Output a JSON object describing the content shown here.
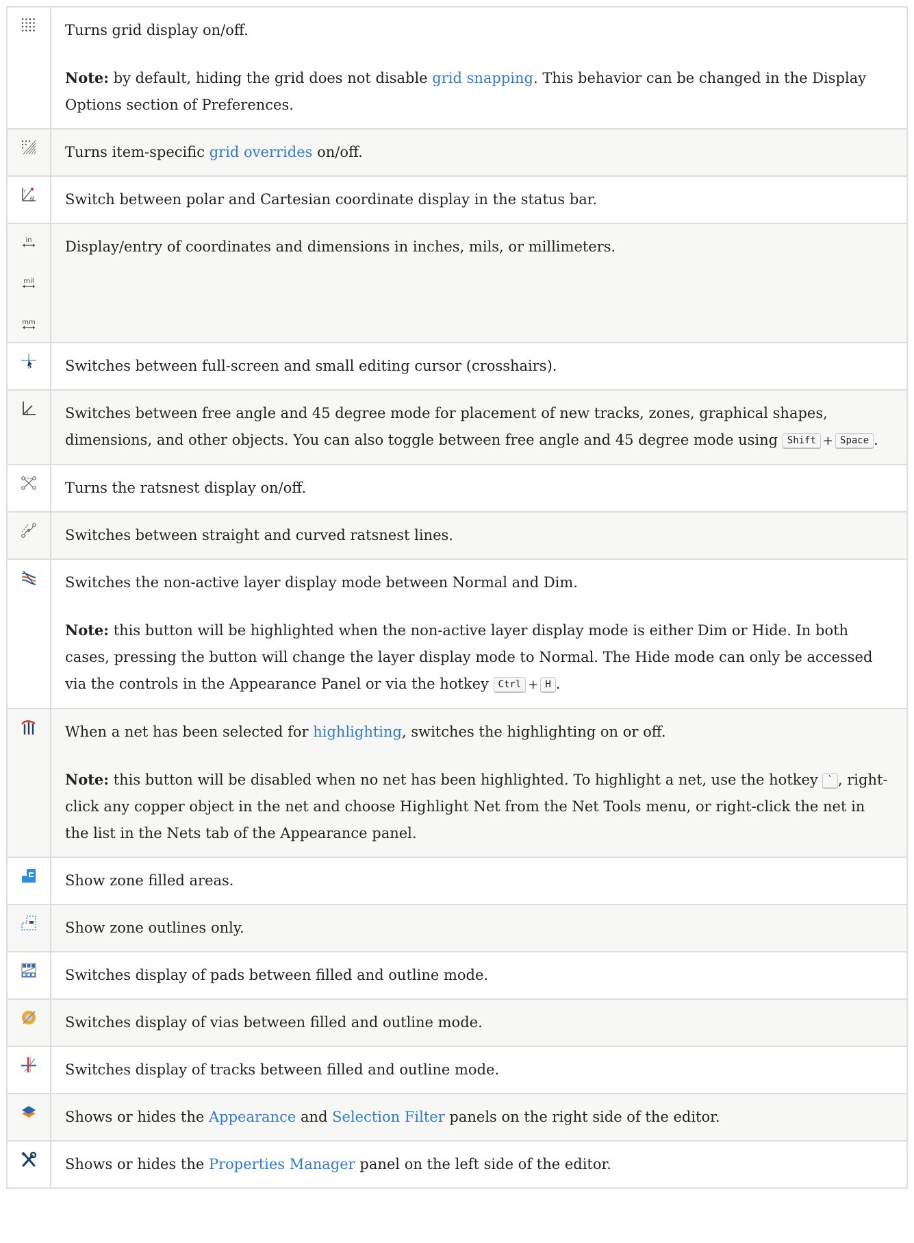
{
  "rows": [
    {
      "icons": [
        "grid-icon"
      ],
      "text": "Turns grid display on/off.",
      "note_label": "Note:",
      "note_pre": " by default, hiding the grid does not disable ",
      "note_link": "grid snapping",
      "note_post": ". This behavior can be changed in the Display Options section of Preferences."
    },
    {
      "icons": [
        "grid-override-icon"
      ],
      "pre": "Turns item-specific ",
      "link": "grid overrides",
      "post": " on/off."
    },
    {
      "icons": [
        "polar-coordinates-icon"
      ],
      "text": "Switch between polar and Cartesian coordinate display in the status bar."
    },
    {
      "icons": [
        "unit-inches-icon",
        "unit-mils-icon",
        "unit-millimeters-icon"
      ],
      "unit_labels": [
        "in",
        "mil",
        "mm"
      ],
      "text": "Display/entry of coordinates and dimensions in inches, mils, or millimeters."
    },
    {
      "icons": [
        "cursor-crosshair-icon"
      ],
      "text": "Switches between full-screen and small editing cursor (crosshairs)."
    },
    {
      "icons": [
        "angle-45-icon"
      ],
      "pre": "Switches between free angle and 45 degree mode for placement of new tracks, zones, graphical shapes, dimensions, and other objects. You can also toggle between free angle and 45 degree mode using ",
      "keys": [
        "Shift",
        "Space"
      ],
      "plus": "+",
      "post": "."
    },
    {
      "icons": [
        "ratsnest-icon"
      ],
      "text": "Turns the ratsnest display on/off."
    },
    {
      "icons": [
        "curved-ratsnest-icon"
      ],
      "text": "Switches between straight and curved ratsnest lines."
    },
    {
      "icons": [
        "contrast-mode-icon"
      ],
      "text": "Switches the non-active layer display mode between Normal and Dim.",
      "note_label": "Note:",
      "note_pre": " this button will be highlighted when the non-active layer display mode is either Dim or Hide. In both cases, pressing the button will change the layer display mode to Normal. The Hide mode can only be accessed via the controls in the Appearance Panel or via the hotkey ",
      "keys": [
        "Ctrl",
        "H"
      ],
      "plus": "+",
      "note_post": "."
    },
    {
      "icons": [
        "net-highlight-icon"
      ],
      "pre": "When a net has been selected for ",
      "link": "highlighting",
      "post": ", switches the highlighting on or off.",
      "note_label": "Note:",
      "note_pre": " this button will be disabled when no net has been highlighted. To highlight a net, use the hotkey ",
      "key": "`",
      "note_post": ", right-click any copper object in the net and choose Highlight Net from the Net Tools menu, or right-click the net in the list in the Nets tab of the Appearance panel."
    },
    {
      "icons": [
        "zone-filled-icon"
      ],
      "text": "Show zone filled areas."
    },
    {
      "icons": [
        "zone-outline-icon"
      ],
      "text": "Show zone outlines only."
    },
    {
      "icons": [
        "pad-display-icon"
      ],
      "text": "Switches display of pads between filled and outline mode."
    },
    {
      "icons": [
        "via-display-icon"
      ],
      "text": "Switches display of vias between filled and outline mode."
    },
    {
      "icons": [
        "track-display-icon"
      ],
      "text": "Switches display of tracks between filled and outline mode."
    },
    {
      "icons": [
        "appearance-panel-icon"
      ],
      "pre": "Shows or hides the ",
      "link": "Appearance",
      "mid": " and ",
      "link2": "Selection Filter",
      "post": " panels on the right side of the editor."
    },
    {
      "icons": [
        "properties-manager-icon"
      ],
      "pre": "Shows or hides the ",
      "link": "Properties Manager",
      "post": " panel on the left side of the editor."
    }
  ]
}
